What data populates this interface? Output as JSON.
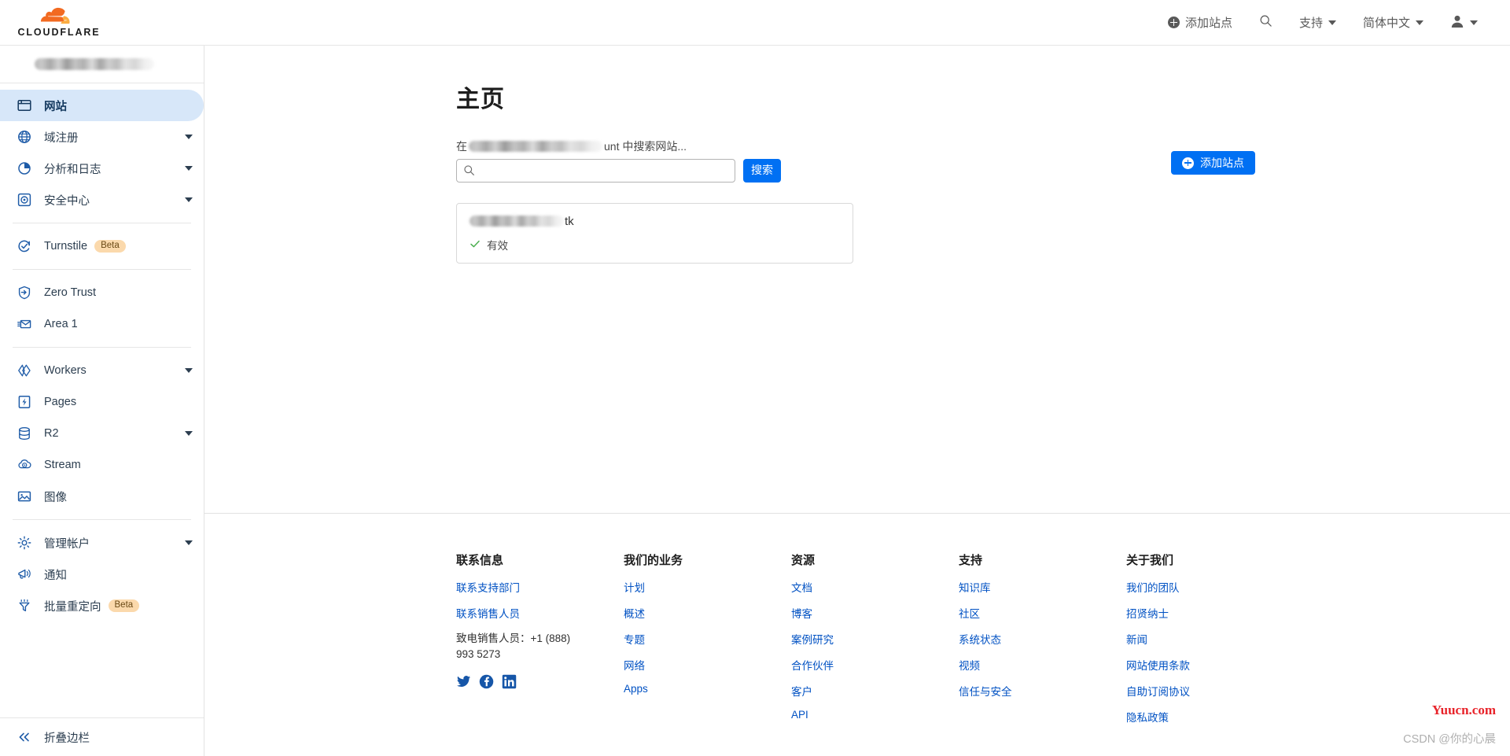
{
  "brand": {
    "logo_text": "CLOUDFLARE",
    "orange_dark": "#f26a21",
    "orange_light": "#fbad41",
    "accent_blue": "#0070f3",
    "link_blue": "#0051c3"
  },
  "topnav": {
    "add_site": "添加站点",
    "search_icon_label": "搜索",
    "support": "支持",
    "language": "简体中文",
    "account_menu": "帐户"
  },
  "sidebar": {
    "account_name": "",
    "items": [
      {
        "label": "网站",
        "icon": "website-icon",
        "active": true,
        "expandable": false,
        "badge": ""
      },
      {
        "label": "域注册",
        "icon": "globe-icon",
        "active": false,
        "expandable": true,
        "badge": ""
      },
      {
        "label": "分析和日志",
        "icon": "analytics-icon",
        "active": false,
        "expandable": true,
        "badge": ""
      },
      {
        "label": "安全中心",
        "icon": "security-icon",
        "active": false,
        "expandable": true,
        "badge": ""
      },
      {
        "label": "Turnstile",
        "icon": "turnstile-icon",
        "active": false,
        "expandable": false,
        "badge": "Beta"
      },
      {
        "label": "Zero Trust",
        "icon": "shield-icon",
        "active": false,
        "expandable": false,
        "badge": ""
      },
      {
        "label": "Area 1",
        "icon": "envelope-icon",
        "active": false,
        "expandable": false,
        "badge": ""
      },
      {
        "label": "Workers",
        "icon": "workers-icon",
        "active": false,
        "expandable": true,
        "badge": ""
      },
      {
        "label": "Pages",
        "icon": "pages-icon",
        "active": false,
        "expandable": false,
        "badge": ""
      },
      {
        "label": "R2",
        "icon": "database-icon",
        "active": false,
        "expandable": true,
        "badge": ""
      },
      {
        "label": "Stream",
        "icon": "stream-icon",
        "active": false,
        "expandable": false,
        "badge": ""
      },
      {
        "label": "图像",
        "icon": "image-icon",
        "active": false,
        "expandable": false,
        "badge": ""
      },
      {
        "label": "管理帐户",
        "icon": "gear-icon",
        "active": false,
        "expandable": true,
        "badge": ""
      },
      {
        "label": "通知",
        "icon": "megaphone-icon",
        "active": false,
        "expandable": false,
        "badge": ""
      },
      {
        "label": "批量重定向",
        "icon": "funnel-icon",
        "active": false,
        "expandable": false,
        "badge": "Beta"
      }
    ],
    "collapse_label": "折叠边栏"
  },
  "main": {
    "title": "主页",
    "search_label_prefix": "在",
    "search_label_suffix": "unt 中搜索网站...",
    "search_value": "",
    "search_placeholder": "",
    "search_button": "搜索",
    "add_site_button": "添加站点",
    "site": {
      "name_suffix": "tk",
      "status": "有效",
      "status_color": "#4caf50"
    }
  },
  "footer": {
    "columns": [
      {
        "title": "联系信息",
        "links": [
          "联系支持部门",
          "联系销售人员"
        ],
        "plain": "致电销售人员：+1 (888) 993 5273",
        "socials": [
          "twitter-icon",
          "facebook-icon",
          "linkedin-icon"
        ]
      },
      {
        "title": "我们的业务",
        "links": [
          "计划",
          "概述",
          "专题",
          "网络",
          "Apps"
        ],
        "plain": "",
        "socials": []
      },
      {
        "title": "资源",
        "links": [
          "文档",
          "博客",
          "案例研究",
          "合作伙伴",
          "客户",
          "API"
        ],
        "plain": "",
        "socials": []
      },
      {
        "title": "支持",
        "links": [
          "知识库",
          "社区",
          "系统状态",
          "视频",
          "信任与安全"
        ],
        "plain": "",
        "socials": []
      },
      {
        "title": "关于我们",
        "links": [
          "我们的团队",
          "招贤纳士",
          "新闻",
          "网站使用条款",
          "自助订阅协议",
          "隐私政策"
        ],
        "plain": "",
        "socials": []
      }
    ]
  },
  "watermarks": {
    "red": "Yuucn.com",
    "grey": "CSDN @你的心晨"
  }
}
